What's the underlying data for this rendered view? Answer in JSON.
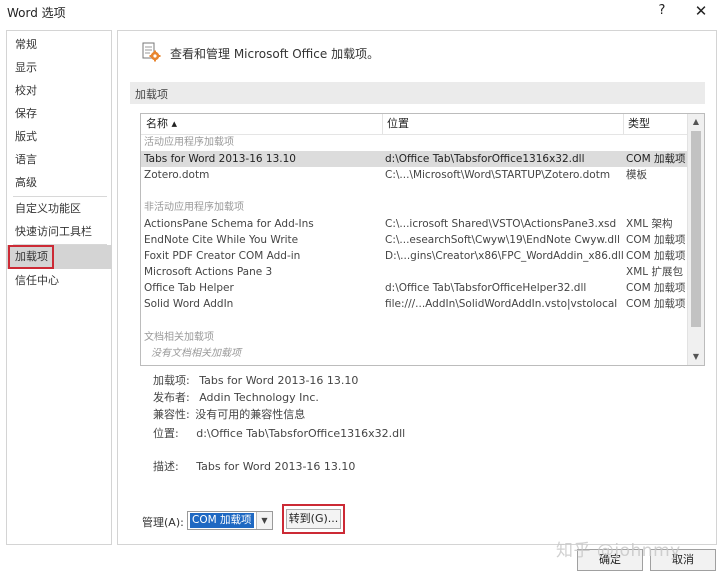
{
  "window": {
    "title": "Word 选项",
    "help": "?",
    "close": "✕"
  },
  "sidebar": {
    "items": [
      {
        "label": "常规"
      },
      {
        "label": "显示"
      },
      {
        "label": "校对"
      },
      {
        "label": "保存"
      },
      {
        "label": "版式"
      },
      {
        "label": "语言"
      },
      {
        "label": "高级"
      },
      {
        "label": "自定义功能区"
      },
      {
        "label": "快速访问工具栏"
      },
      {
        "label": "加载项"
      },
      {
        "label": "信任中心"
      }
    ],
    "active_index": 9
  },
  "header": {
    "text": "查看和管理 Microsoft Office 加载项。",
    "icon": "addins-gear-icon"
  },
  "section": {
    "label": "加载项"
  },
  "table": {
    "columns": [
      "名称 ▴",
      "位置",
      "类型"
    ],
    "groups": {
      "active": "活动应用程序加载项",
      "inactive": "非活动应用程序加载项",
      "document": "文档相关加载项",
      "document_empty": "没有文档相关加载项"
    },
    "active_rows": [
      {
        "name": "Tabs for Word 2013-16 13.10",
        "location": "d:\\Office Tab\\TabsforOffice1316x32.dll",
        "type": "COM 加载项",
        "selected": true
      },
      {
        "name": "Zotero.dotm",
        "location": "C:\\...\\Microsoft\\Word\\STARTUP\\Zotero.dotm",
        "type": "模板"
      }
    ],
    "inactive_rows": [
      {
        "name": "ActionsPane Schema for Add-Ins",
        "location": "C:\\...icrosoft Shared\\VSTO\\ActionsPane3.xsd",
        "type": "XML 架构"
      },
      {
        "name": "EndNote Cite While You Write",
        "location": "C:\\...esearchSoft\\Cwyw\\19\\EndNote Cwyw.dll",
        "type": "COM 加载项"
      },
      {
        "name": "Foxit PDF Creator COM Add-in",
        "location": "D:\\...gins\\Creator\\x86\\FPC_WordAddin_x86.dll",
        "type": "COM 加载项"
      },
      {
        "name": "Microsoft Actions Pane 3",
        "location": "",
        "type": "XML 扩展包"
      },
      {
        "name": "Office Tab Helper",
        "location": "d:\\Office Tab\\TabsforOfficeHelper32.dll",
        "type": "COM 加载项"
      },
      {
        "name": "Solid Word AddIn",
        "location": "file:///...AddIn\\SolidWordAddIn.vsto|vstolocal",
        "type": "COM 加载项"
      }
    ]
  },
  "details": {
    "addin_label": "加载项:",
    "addin_value": "Tabs for Word 2013-16 13.10",
    "publisher_label": "发布者:",
    "publisher_value": "Addin Technology Inc.",
    "compat_label": "兼容性:",
    "compat_value": "没有可用的兼容性信息",
    "location_label": "位置:",
    "location_value": "d:\\Office Tab\\TabsforOffice1316x32.dll",
    "desc_label": "描述:",
    "desc_value": "Tabs for Word 2013-16 13.10"
  },
  "manage": {
    "label": "管理(A):",
    "selected": "COM 加载项",
    "goto_label": "转到(G)..."
  },
  "footer": {
    "ok": "确定",
    "cancel": "取消"
  },
  "watermark": "知乎 @johnmy",
  "colors": {
    "accent_select": "#1e68c2",
    "highlight_box": "#cc2a35",
    "active_nav": "#d4d4d4"
  }
}
